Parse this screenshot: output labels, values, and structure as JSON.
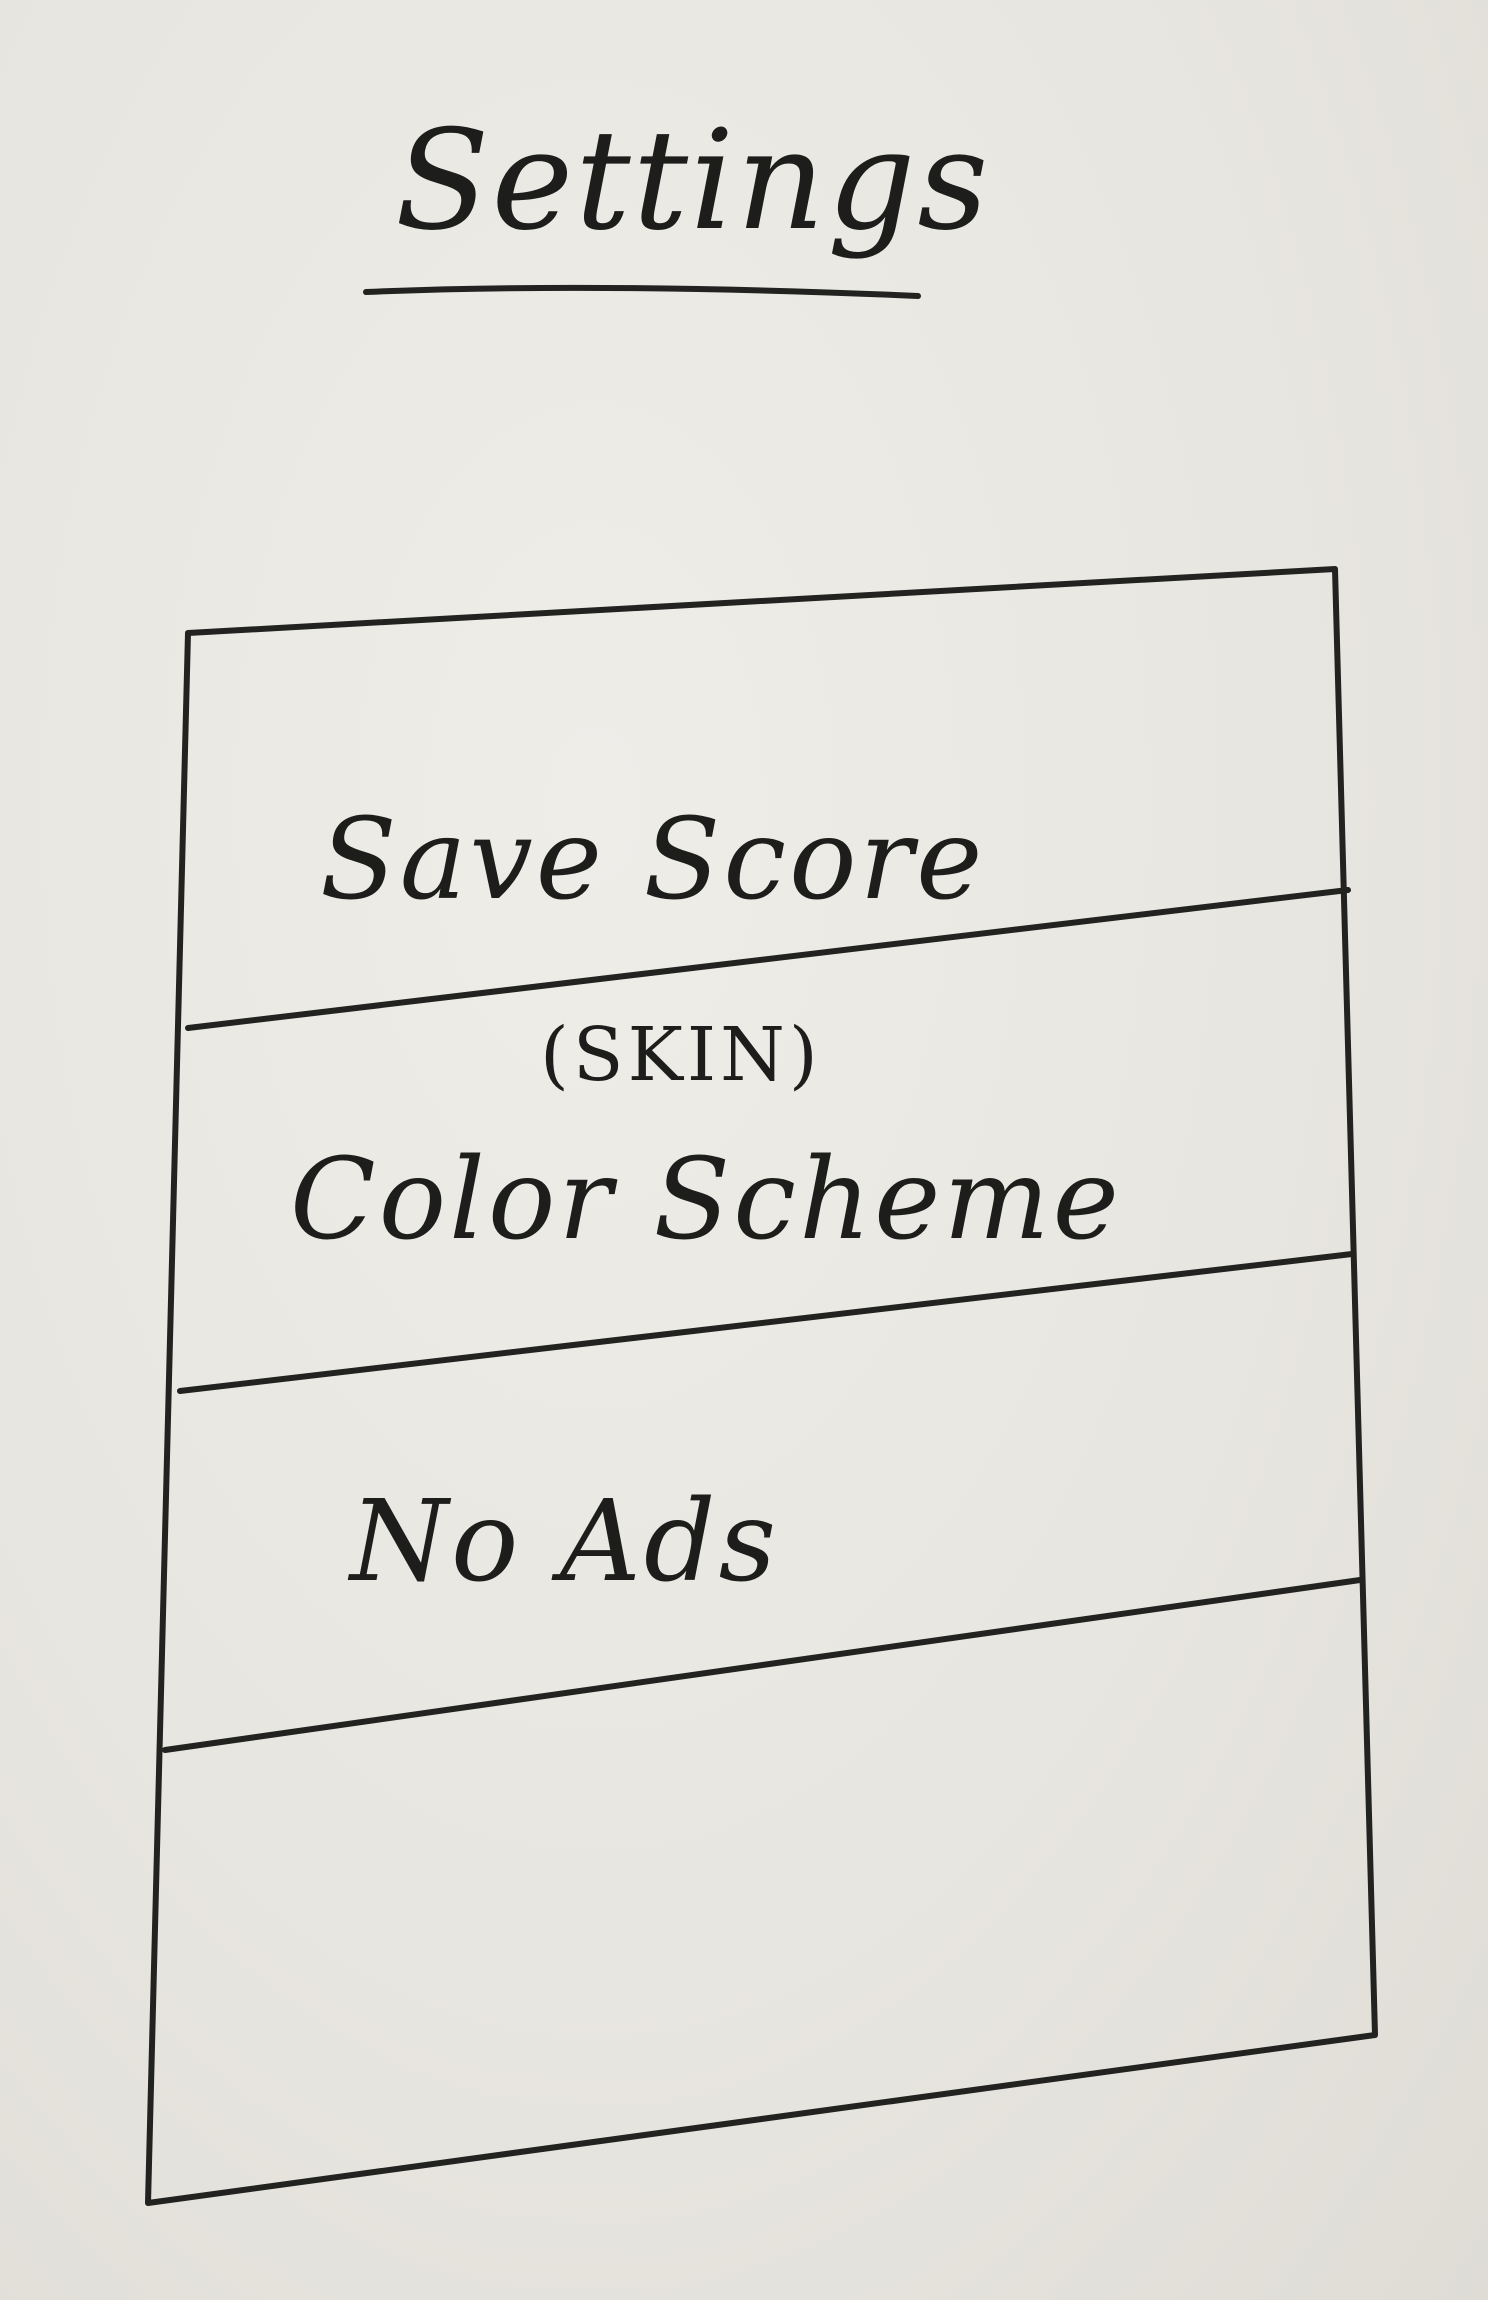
{
  "header": {
    "title": "Settings"
  },
  "settings_list": {
    "items": [
      {
        "label": "Save Score",
        "note": ""
      },
      {
        "label": "Color Scheme",
        "note": "(SKIN)"
      },
      {
        "label": "No Ads",
        "note": ""
      },
      {
        "label": "",
        "note": ""
      }
    ]
  },
  "colors": {
    "paper": "#e8e6e0",
    "ink": "#1d1d1b"
  }
}
